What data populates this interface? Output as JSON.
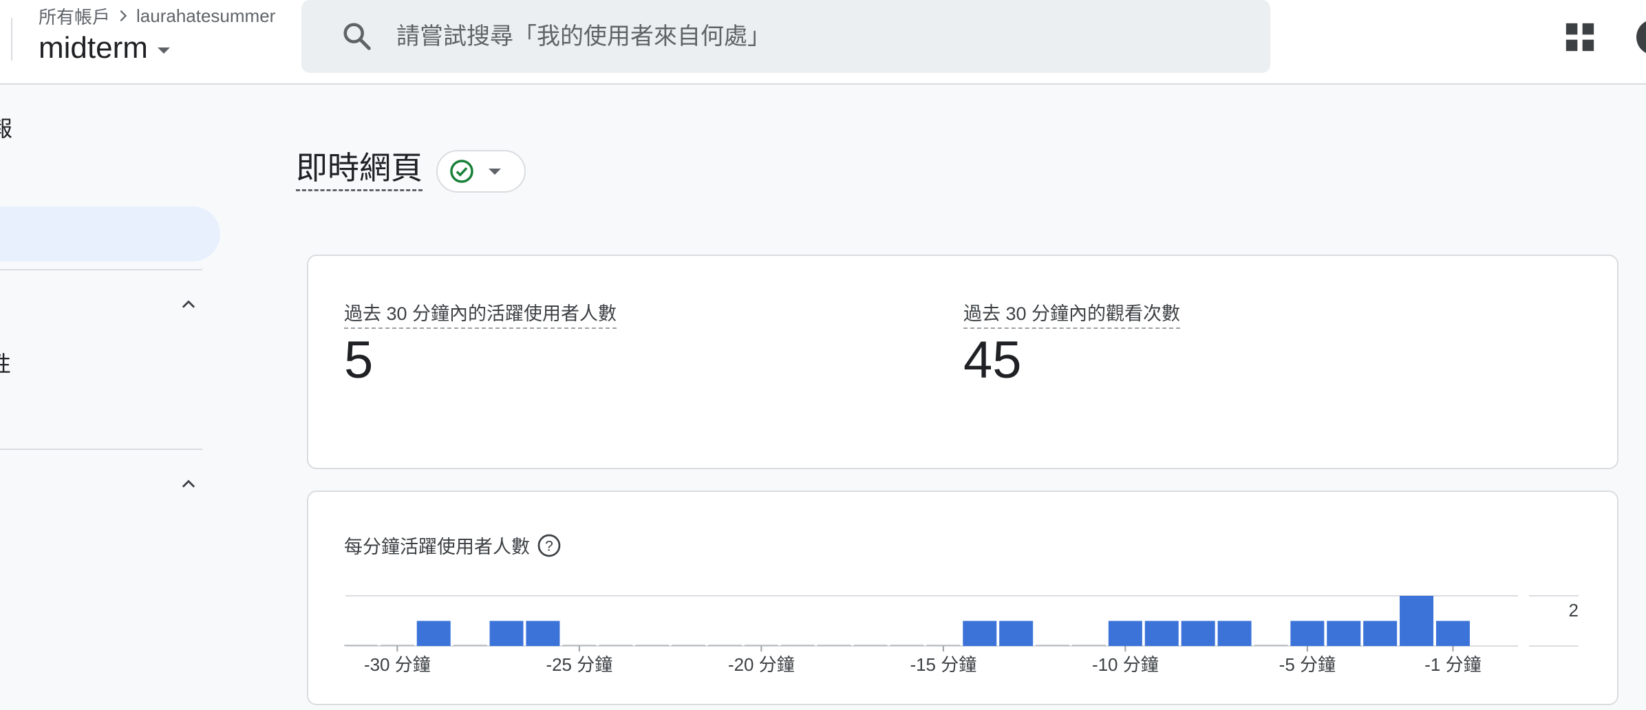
{
  "header": {
    "breadcrumb_root": "所有帳戶",
    "breadcrumb_account": "laurahatesummer",
    "property_name": "midterm"
  },
  "search": {
    "placeholder": "請嘗試搜尋「我的使用者來自何處」"
  },
  "nav": {
    "fragment_1": "報",
    "fragment_2": "性"
  },
  "page": {
    "title": "即時網頁"
  },
  "metrics": [
    {
      "label": "過去 30 分鐘內的活躍使用者人數",
      "value": "5"
    },
    {
      "label": "過去 30 分鐘內的觀看次數",
      "value": "45"
    }
  ],
  "chart_card": {
    "title": "每分鐘活躍使用者人數"
  },
  "colors": {
    "bar": "#3b73d9",
    "accent_green": "#188038",
    "active_nav": "#e8f0fe"
  },
  "chart_data": {
    "type": "bar",
    "title": "每分鐘活躍使用者人數",
    "categories": [
      "-31",
      "-30",
      "-29",
      "-28",
      "-27",
      "-26",
      "-25",
      "-24",
      "-23",
      "-22",
      "-21",
      "-20",
      "-19",
      "-18",
      "-17",
      "-16",
      "-15",
      "-14",
      "-13",
      "-12",
      "-11",
      "-10",
      "-9",
      "-8",
      "-7",
      "-6",
      "-5",
      "-4",
      "-3",
      "-2",
      "-1"
    ],
    "values": [
      0,
      0,
      1,
      0,
      1,
      1,
      0,
      0,
      0,
      0,
      0,
      0,
      0,
      0,
      0,
      0,
      0,
      1,
      1,
      0,
      0,
      1,
      1,
      1,
      1,
      0,
      1,
      1,
      1,
      2,
      1
    ],
    "x_tick_labels": [
      "-30 分鐘",
      "-25 分鐘",
      "-20 分鐘",
      "-15 分鐘",
      "-10 分鐘",
      "-5 分鐘",
      "-1 分鐘"
    ],
    "x_tick_categories": [
      "-30",
      "-25",
      "-20",
      "-15",
      "-10",
      "-5",
      "-1"
    ],
    "y_tick_labels": [
      "2"
    ],
    "ylim": [
      0,
      2
    ],
    "grid": true,
    "xlabel": "",
    "ylabel": ""
  }
}
